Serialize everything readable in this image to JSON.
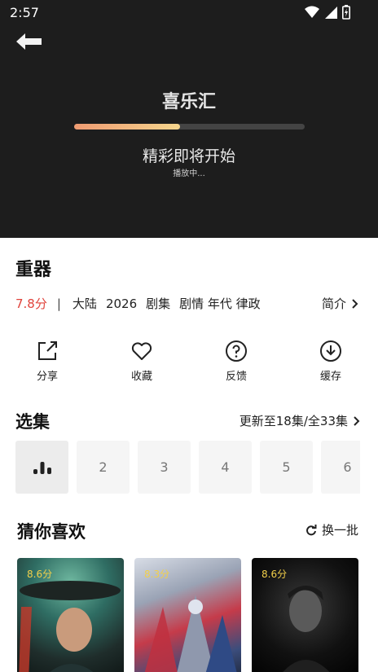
{
  "status": {
    "time": "2:57"
  },
  "player": {
    "title": "喜乐汇",
    "progress": 0.46,
    "start_text": "精彩即将开始",
    "sub_text": "播放中..."
  },
  "show": {
    "title": "重器",
    "rating": "7.8分",
    "separator": "|",
    "region": "大陆",
    "year": "2026",
    "type": "剧集",
    "genres": "剧情 年代 律政",
    "intro_label": "简介"
  },
  "actions": [
    {
      "label": "分享",
      "icon": "share-icon"
    },
    {
      "label": "收藏",
      "icon": "heart-icon"
    },
    {
      "label": "反馈",
      "icon": "question-icon"
    },
    {
      "label": "缓存",
      "icon": "download-icon"
    }
  ],
  "episodes": {
    "title": "选集",
    "more_label": "更新至18集/全33集",
    "items": [
      "",
      "2",
      "3",
      "4",
      "5",
      "6"
    ]
  },
  "recommend": {
    "title": "猜你喜欢",
    "refresh_label": "换一批",
    "cards": [
      {
        "score": "8.6分"
      },
      {
        "score": "8.3分"
      },
      {
        "score": "8.6分"
      }
    ]
  },
  "colors": {
    "rating": "#e0433b",
    "progress_start": "#ef9b72",
    "progress_end": "#f5d58c",
    "score": "#f2cf4a"
  }
}
